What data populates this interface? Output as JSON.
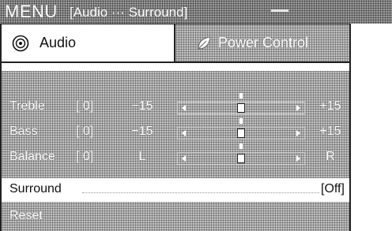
{
  "title_bar": {
    "menu": "MENU",
    "path": "[Audio ··· Surround]"
  },
  "tabs": [
    {
      "label": "Audio",
      "icon": "speaker-icon",
      "selected": true
    },
    {
      "label": "Power Control",
      "icon": "leaf-icon",
      "selected": false
    }
  ],
  "settings": {
    "treble": {
      "label": "Treble",
      "value": "[ 0]",
      "min": "−15",
      "max": "+15",
      "level": 0
    },
    "bass": {
      "label": "Bass",
      "value": "[ 0]",
      "min": "−15",
      "max": "+15",
      "level": 0
    },
    "balance": {
      "label": "Balance",
      "value": "[ 0]",
      "min": "L",
      "max": "R",
      "level": 0
    },
    "surround": {
      "label": "Surround",
      "value": "[Off]"
    },
    "reset": {
      "label": "Reset"
    }
  }
}
